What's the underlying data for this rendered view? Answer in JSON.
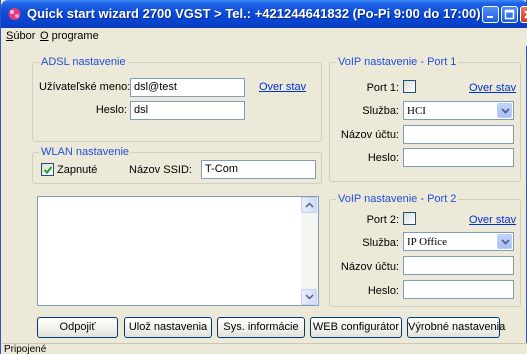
{
  "window": {
    "title": "Quick start wizard 2700 VGST > Tel.: +421244641832 (Po-Pi 9:00 do 17:00)"
  },
  "menu": {
    "items": [
      "Súbor",
      "O programe"
    ]
  },
  "adsl": {
    "legend": "ADSL nastavenie",
    "username_label": "Užívateľské meno:",
    "username_value": "dsl@test",
    "password_label": "Heslo:",
    "password_value": "dsl",
    "check_link": "Over stav"
  },
  "wlan": {
    "legend": "WLAN nastavenie",
    "enabled_label": "Zapnuté",
    "enabled_checked": true,
    "ssid_label": "Názov SSID:",
    "ssid_value": "T-Com"
  },
  "voip1": {
    "legend": "VoIP nastavenie - Port 1",
    "port_label": "Port 1:",
    "port_checked": false,
    "check_link": "Over stav",
    "service_label": "Služba:",
    "service_value": "HCI",
    "account_label": "Názov účtu:",
    "account_value": "",
    "password_label": "Heslo:",
    "password_value": ""
  },
  "voip2": {
    "legend": "VoIP nastavenie - Port 2",
    "port_label": "Port 2:",
    "port_checked": false,
    "check_link": "Over stav",
    "service_label": "Služba:",
    "service_value": "IP Office",
    "account_label": "Názov účtu:",
    "account_value": "",
    "password_label": "Heslo:",
    "password_value": ""
  },
  "buttons": {
    "disconnect": "Odpojiť",
    "save": "Ulož nastavenia",
    "sysinfo": "Sys. informácie",
    "web": "WEB configurátor",
    "factory": "Výrobné nastavenia"
  },
  "status": {
    "text": "Pripojené"
  },
  "colors": {
    "title_bar": "#0a4ad8",
    "group_legend": "#1f4fd8",
    "link": "#0033cc"
  }
}
